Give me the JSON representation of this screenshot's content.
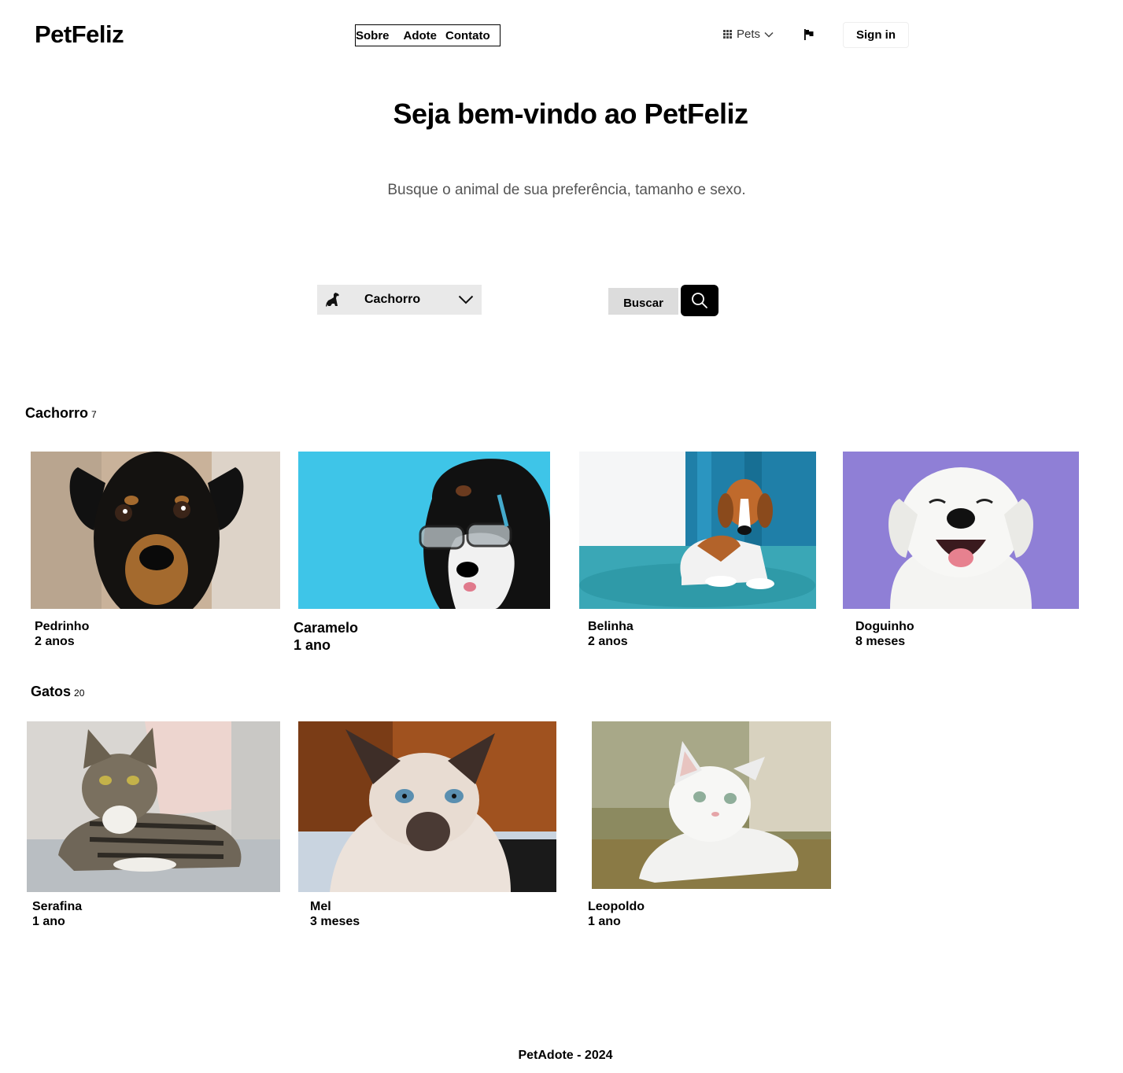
{
  "header": {
    "logo": "PetFeliz",
    "nav": [
      "Sobre",
      "Adote",
      "Contato"
    ],
    "pets_menu": "Pets",
    "signin": "Sign in"
  },
  "hero": {
    "title": "Seja bem-vindo ao PetFeliz",
    "subtitle": "Busque o animal de sua preferência, tamanho e sexo."
  },
  "search": {
    "selected_animal": "Cachorro",
    "buscar_label": "Buscar"
  },
  "sections": {
    "dogs": {
      "title": "Cachorro",
      "count": "7",
      "pets": [
        {
          "name": "Pedrinho",
          "age": "2 anos"
        },
        {
          "name": "Caramelo",
          "age": "1 ano"
        },
        {
          "name": "Belinha",
          "age": "2 anos"
        },
        {
          "name": "Doguinho",
          "age": "8 meses"
        }
      ]
    },
    "cats": {
      "title": "Gatos",
      "count": "20",
      "pets": [
        {
          "name": "Serafina",
          "age": "1 ano"
        },
        {
          "name": "Mel",
          "age": "3 meses"
        },
        {
          "name": "Leopoldo",
          "age": "1 ano"
        }
      ]
    }
  },
  "footer": {
    "text": "PetAdote - 2024"
  },
  "colors": {
    "photo_bg_pedrinho": "#c9b29a",
    "photo_bg_caramelo": "#3ec5e8",
    "photo_bg_belinha": "#2f8fb3",
    "photo_bg_doguinho": "#8f7fd6",
    "photo_bg_serafina": "#d9d6d2",
    "photo_bg_mel": "#a0521f",
    "photo_bg_leopoldo": "#8c8a60"
  },
  "icons": {
    "dog": "dog-icon",
    "search": "search-icon",
    "flag": "flag-icon",
    "grid": "grid-icon",
    "chevron": "chevron-down-icon"
  }
}
